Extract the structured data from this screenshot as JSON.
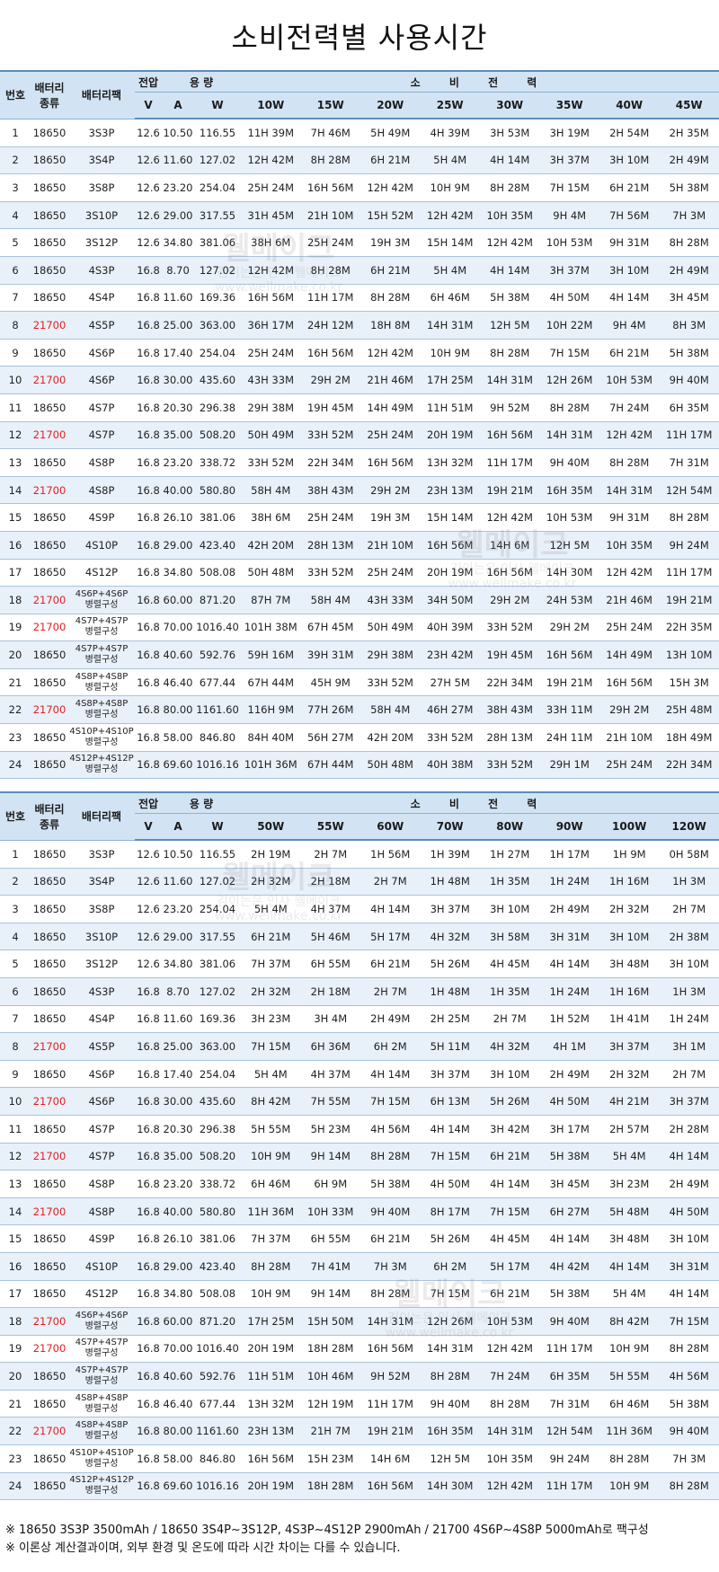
{
  "title": "소비전력별 사용시간",
  "headers": {
    "no": "번호",
    "battery_type": "배터리 종류",
    "pack": "배터리팩",
    "voltage_group": "전압",
    "capacity_group": "용 량",
    "consumption_group": "소 비 전 력",
    "v": "V",
    "a": "A",
    "w": "W"
  },
  "table1": {
    "watts": [
      "10W",
      "15W",
      "20W",
      "25W",
      "30W",
      "35W",
      "40W",
      "45W"
    ],
    "rows": [
      {
        "no": "1",
        "type": "18650",
        "pack": "3S3P",
        "v": "12.6",
        "a": "10.50",
        "w": "116.55",
        "t": [
          "11H 39M",
          "7H 46M",
          "5H 49M",
          "4H 39M",
          "3H 53M",
          "3H 19M",
          "2H 54M",
          "2H 35M"
        ]
      },
      {
        "no": "2",
        "type": "18650",
        "pack": "3S4P",
        "v": "12.6",
        "a": "11.60",
        "w": "127.02",
        "t": [
          "12H 42M",
          "8H 28M",
          "6H 21M",
          "5H 4M",
          "4H 14M",
          "3H 37M",
          "3H 10M",
          "2H 49M"
        ]
      },
      {
        "no": "3",
        "type": "18650",
        "pack": "3S8P",
        "v": "12.6",
        "a": "23.20",
        "w": "254.04",
        "t": [
          "25H 24M",
          "16H 56M",
          "12H 42M",
          "10H 9M",
          "8H 28M",
          "7H 15M",
          "6H 21M",
          "5H 38M"
        ]
      },
      {
        "no": "4",
        "type": "18650",
        "pack": "3S10P",
        "v": "12.6",
        "a": "29.00",
        "w": "317.55",
        "t": [
          "31H 45M",
          "21H 10M",
          "15H 52M",
          "12H 42M",
          "10H 35M",
          "9H 4M",
          "7H 56M",
          "7H 3M"
        ]
      },
      {
        "no": "5",
        "type": "18650",
        "pack": "3S12P",
        "v": "12.6",
        "a": "34.80",
        "w": "381.06",
        "t": [
          "38H 6M",
          "25H 24M",
          "19H 3M",
          "15H 14M",
          "12H 42M",
          "10H 53M",
          "9H 31M",
          "8H 28M"
        ]
      },
      {
        "no": "6",
        "type": "18650",
        "pack": "4S3P",
        "v": "16.8",
        "a": "8.70",
        "w": "127.02",
        "t": [
          "12H 42M",
          "8H 28M",
          "6H 21M",
          "5H 4M",
          "4H 14M",
          "3H 37M",
          "3H 10M",
          "2H 49M"
        ]
      },
      {
        "no": "7",
        "type": "18650",
        "pack": "4S4P",
        "v": "16.8",
        "a": "11.60",
        "w": "169.36",
        "t": [
          "16H 56M",
          "11H 17M",
          "8H 28M",
          "6H 46M",
          "5H 38M",
          "4H 50M",
          "4H 14M",
          "3H 45M"
        ]
      },
      {
        "no": "8",
        "type": "21700",
        "pack": "4S5P",
        "v": "16.8",
        "a": "25.00",
        "w": "363.00",
        "t": [
          "36H 17M",
          "24H 12M",
          "18H 8M",
          "14H 31M",
          "12H 5M",
          "10H 22M",
          "9H 4M",
          "8H 3M"
        ]
      },
      {
        "no": "9",
        "type": "18650",
        "pack": "4S6P",
        "v": "16.8",
        "a": "17.40",
        "w": "254.04",
        "t": [
          "25H 24M",
          "16H 56M",
          "12H 42M",
          "10H 9M",
          "8H 28M",
          "7H 15M",
          "6H 21M",
          "5H 38M"
        ]
      },
      {
        "no": "10",
        "type": "21700",
        "pack": "4S6P",
        "v": "16.8",
        "a": "30.00",
        "w": "435.60",
        "t": [
          "43H 33M",
          "29H 2M",
          "21H 46M",
          "17H 25M",
          "14H 31M",
          "12H 26M",
          "10H 53M",
          "9H 40M"
        ]
      },
      {
        "no": "11",
        "type": "18650",
        "pack": "4S7P",
        "v": "16.8",
        "a": "20.30",
        "w": "296.38",
        "t": [
          "29H 38M",
          "19H 45M",
          "14H 49M",
          "11H 51M",
          "9H 52M",
          "8H 28M",
          "7H 24M",
          "6H 35M"
        ]
      },
      {
        "no": "12",
        "type": "21700",
        "pack": "4S7P",
        "v": "16.8",
        "a": "35.00",
        "w": "508.20",
        "t": [
          "50H 49M",
          "33H 52M",
          "25H 24M",
          "20H 19M",
          "16H 56M",
          "14H 31M",
          "12H 42M",
          "11H 17M"
        ]
      },
      {
        "no": "13",
        "type": "18650",
        "pack": "4S8P",
        "v": "16.8",
        "a": "23.20",
        "w": "338.72",
        "t": [
          "33H 52M",
          "22H 34M",
          "16H 56M",
          "13H 32M",
          "11H 17M",
          "9H 40M",
          "8H 28M",
          "7H 31M"
        ]
      },
      {
        "no": "14",
        "type": "21700",
        "pack": "4S8P",
        "v": "16.8",
        "a": "40.00",
        "w": "580.80",
        "t": [
          "58H 4M",
          "38H 43M",
          "29H 2M",
          "23H 13M",
          "19H 21M",
          "16H 35M",
          "14H 31M",
          "12H 54M"
        ]
      },
      {
        "no": "15",
        "type": "18650",
        "pack": "4S9P",
        "v": "16.8",
        "a": "26.10",
        "w": "381.06",
        "t": [
          "38H 6M",
          "25H 24M",
          "19H 3M",
          "15H 14M",
          "12H 42M",
          "10H 53M",
          "9H 31M",
          "8H 28M"
        ]
      },
      {
        "no": "16",
        "type": "18650",
        "pack": "4S10P",
        "v": "16.8",
        "a": "29.00",
        "w": "423.40",
        "t": [
          "42H 20M",
          "28H 13M",
          "21H 10M",
          "16H 56M",
          "14H 6M",
          "12H 5M",
          "10H 35M",
          "9H 24M"
        ]
      },
      {
        "no": "17",
        "type": "18650",
        "pack": "4S12P",
        "v": "16.8",
        "a": "34.80",
        "w": "508.08",
        "t": [
          "50H 48M",
          "33H 52M",
          "25H 24M",
          "20H 19M",
          "16H 56M",
          "14H 30M",
          "12H 42M",
          "11H 17M"
        ]
      },
      {
        "no": "18",
        "type": "21700",
        "pack": "4S6P+4S6P",
        "pack2": "병렬구성",
        "v": "16.8",
        "a": "60.00",
        "w": "871.20",
        "t": [
          "87H 7M",
          "58H 4M",
          "43H 33M",
          "34H 50M",
          "29H 2M",
          "24H 53M",
          "21H 46M",
          "19H 21M"
        ]
      },
      {
        "no": "19",
        "type": "21700",
        "pack": "4S7P+4S7P",
        "pack2": "병렬구성",
        "v": "16.8",
        "a": "70.00",
        "w": "1016.40",
        "t": [
          "101H 38M",
          "67H 45M",
          "50H 49M",
          "40H 39M",
          "33H 52M",
          "29H 2M",
          "25H 24M",
          "22H 35M"
        ]
      },
      {
        "no": "20",
        "type": "18650",
        "pack": "4S7P+4S7P",
        "pack2": "병렬구성",
        "v": "16.8",
        "a": "40.60",
        "w": "592.76",
        "t": [
          "59H 16M",
          "39H 31M",
          "29H 38M",
          "23H 42M",
          "19H 45M",
          "16H 56M",
          "14H 49M",
          "13H 10M"
        ]
      },
      {
        "no": "21",
        "type": "18650",
        "pack": "4S8P+4S8P",
        "pack2": "병렬구성",
        "v": "16.8",
        "a": "46.40",
        "w": "677.44",
        "t": [
          "67H 44M",
          "45H 9M",
          "33H 52M",
          "27H 5M",
          "22H 34M",
          "19H 21M",
          "16H 56M",
          "15H 3M"
        ]
      },
      {
        "no": "22",
        "type": "21700",
        "pack": "4S8P+4S8P",
        "pack2": "병렬구성",
        "v": "16.8",
        "a": "80.00",
        "w": "1161.60",
        "t": [
          "116H 9M",
          "77H 26M",
          "58H 4M",
          "46H 27M",
          "38H 43M",
          "33H 11M",
          "29H 2M",
          "25H 48M"
        ]
      },
      {
        "no": "23",
        "type": "18650",
        "pack": "4S10P+4S10P",
        "pack2": "병렬구성",
        "v": "16.8",
        "a": "58.00",
        "w": "846.80",
        "t": [
          "84H 40M",
          "56H 27M",
          "42H 20M",
          "33H 52M",
          "28H 13M",
          "24H 11M",
          "21H 10M",
          "18H 49M"
        ]
      },
      {
        "no": "24",
        "type": "18650",
        "pack": "4S12P+4S12P",
        "pack2": "병렬구성",
        "v": "16.8",
        "a": "69.60",
        "w": "1016.16",
        "t": [
          "101H 36M",
          "67H 44M",
          "50H 48M",
          "40H 38M",
          "33H 52M",
          "29H 1M",
          "25H 24M",
          "22H 34M"
        ]
      }
    ]
  },
  "table2": {
    "watts": [
      "50W",
      "55W",
      "60W",
      "70W",
      "80W",
      "90W",
      "100W",
      "120W"
    ],
    "rows": [
      {
        "no": "1",
        "type": "18650",
        "pack": "3S3P",
        "v": "12.6",
        "a": "10.50",
        "w": "116.55",
        "t": [
          "2H 19M",
          "2H 7M",
          "1H 56M",
          "1H 39M",
          "1H 27M",
          "1H 17M",
          "1H 9M",
          "0H 58M"
        ]
      },
      {
        "no": "2",
        "type": "18650",
        "pack": "3S4P",
        "v": "12.6",
        "a": "11.60",
        "w": "127.02",
        "t": [
          "2H 32M",
          "2H 18M",
          "2H 7M",
          "1H 48M",
          "1H 35M",
          "1H 24M",
          "1H 16M",
          "1H 3M"
        ]
      },
      {
        "no": "3",
        "type": "18650",
        "pack": "3S8P",
        "v": "12.6",
        "a": "23.20",
        "w": "254.04",
        "t": [
          "5H 4M",
          "4H 37M",
          "4H 14M",
          "3H 37M",
          "3H 10M",
          "2H 49M",
          "2H 32M",
          "2H 7M"
        ]
      },
      {
        "no": "4",
        "type": "18650",
        "pack": "3S10P",
        "v": "12.6",
        "a": "29.00",
        "w": "317.55",
        "t": [
          "6H 21M",
          "5H 46M",
          "5H 17M",
          "4H 32M",
          "3H 58M",
          "3H 31M",
          "3H 10M",
          "2H 38M"
        ]
      },
      {
        "no": "5",
        "type": "18650",
        "pack": "3S12P",
        "v": "12.6",
        "a": "34.80",
        "w": "381.06",
        "t": [
          "7H 37M",
          "6H 55M",
          "6H 21M",
          "5H 26M",
          "4H 45M",
          "4H 14M",
          "3H 48M",
          "3H 10M"
        ]
      },
      {
        "no": "6",
        "type": "18650",
        "pack": "4S3P",
        "v": "16.8",
        "a": "8.70",
        "w": "127.02",
        "t": [
          "2H 32M",
          "2H 18M",
          "2H 7M",
          "1H 48M",
          "1H 35M",
          "1H 24M",
          "1H 16M",
          "1H 3M"
        ]
      },
      {
        "no": "7",
        "type": "18650",
        "pack": "4S4P",
        "v": "16.8",
        "a": "11.60",
        "w": "169.36",
        "t": [
          "3H 23M",
          "3H 4M",
          "2H 49M",
          "2H 25M",
          "2H 7M",
          "1H 52M",
          "1H 41M",
          "1H 24M"
        ]
      },
      {
        "no": "8",
        "type": "21700",
        "pack": "4S5P",
        "v": "16.8",
        "a": "25.00",
        "w": "363.00",
        "t": [
          "7H 15M",
          "6H 36M",
          "6H 2M",
          "5H 11M",
          "4H 32M",
          "4H 1M",
          "3H 37M",
          "3H 1M"
        ]
      },
      {
        "no": "9",
        "type": "18650",
        "pack": "4S6P",
        "v": "16.8",
        "a": "17.40",
        "w": "254.04",
        "t": [
          "5H 4M",
          "4H 37M",
          "4H 14M",
          "3H 37M",
          "3H 10M",
          "2H 49M",
          "2H 32M",
          "2H 7M"
        ]
      },
      {
        "no": "10",
        "type": "21700",
        "pack": "4S6P",
        "v": "16.8",
        "a": "30.00",
        "w": "435.60",
        "t": [
          "8H 42M",
          "7H 55M",
          "7H 15M",
          "6H 13M",
          "5H 26M",
          "4H 50M",
          "4H 21M",
          "3H 37M"
        ]
      },
      {
        "no": "11",
        "type": "18650",
        "pack": "4S7P",
        "v": "16.8",
        "a": "20.30",
        "w": "296.38",
        "t": [
          "5H 55M",
          "5H 23M",
          "4H 56M",
          "4H 14M",
          "3H 42M",
          "3H 17M",
          "2H 57M",
          "2H 28M"
        ]
      },
      {
        "no": "12",
        "type": "21700",
        "pack": "4S7P",
        "v": "16.8",
        "a": "35.00",
        "w": "508.20",
        "t": [
          "10H 9M",
          "9H 14M",
          "8H 28M",
          "7H 15M",
          "6H 21M",
          "5H 38M",
          "5H 4M",
          "4H 14M"
        ]
      },
      {
        "no": "13",
        "type": "18650",
        "pack": "4S8P",
        "v": "16.8",
        "a": "23.20",
        "w": "338.72",
        "t": [
          "6H 46M",
          "6H 9M",
          "5H 38M",
          "4H 50M",
          "4H 14M",
          "3H 45M",
          "3H 23M",
          "2H 49M"
        ]
      },
      {
        "no": "14",
        "type": "21700",
        "pack": "4S8P",
        "v": "16.8",
        "a": "40.00",
        "w": "580.80",
        "t": [
          "11H 36M",
          "10H 33M",
          "9H 40M",
          "8H 17M",
          "7H 15M",
          "6H 27M",
          "5H 48M",
          "4H 50M"
        ]
      },
      {
        "no": "15",
        "type": "18650",
        "pack": "4S9P",
        "v": "16.8",
        "a": "26.10",
        "w": "381.06",
        "t": [
          "7H 37M",
          "6H 55M",
          "6H 21M",
          "5H 26M",
          "4H 45M",
          "4H 14M",
          "3H 48M",
          "3H 10M"
        ]
      },
      {
        "no": "16",
        "type": "18650",
        "pack": "4S10P",
        "v": "16.8",
        "a": "29.00",
        "w": "423.40",
        "t": [
          "8H 28M",
          "7H 41M",
          "7H 3M",
          "6H 2M",
          "5H 17M",
          "4H 42M",
          "4H 14M",
          "3H 31M"
        ]
      },
      {
        "no": "17",
        "type": "18650",
        "pack": "4S12P",
        "v": "16.8",
        "a": "34.80",
        "w": "508.08",
        "t": [
          "10H 9M",
          "9H 14M",
          "8H 28M",
          "7H 15M",
          "6H 21M",
          "5H 38M",
          "5H 4M",
          "4H 14M"
        ]
      },
      {
        "no": "18",
        "type": "21700",
        "pack": "4S6P+4S6P",
        "pack2": "병렬구성",
        "v": "16.8",
        "a": "60.00",
        "w": "871.20",
        "t": [
          "17H 25M",
          "15H 50M",
          "14H 31M",
          "12H 26M",
          "10H 53M",
          "9H 40M",
          "8H 42M",
          "7H 15M"
        ]
      },
      {
        "no": "19",
        "type": "21700",
        "pack": "4S7P+4S7P",
        "pack2": "병렬구성",
        "v": "16.8",
        "a": "70.00",
        "w": "1016.40",
        "t": [
          "20H 19M",
          "18H 28M",
          "16H 56M",
          "14H 31M",
          "12H 42M",
          "11H 17M",
          "10H 9M",
          "8H 28M"
        ]
      },
      {
        "no": "20",
        "type": "18650",
        "pack": "4S7P+4S7P",
        "pack2": "병렬구성",
        "v": "16.8",
        "a": "40.60",
        "w": "592.76",
        "t": [
          "11H 51M",
          "10H 46M",
          "9H 52M",
          "8H 28M",
          "7H 24M",
          "6H 35M",
          "5H 55M",
          "4H 56M"
        ]
      },
      {
        "no": "21",
        "type": "18650",
        "pack": "4S8P+4S8P",
        "pack2": "병렬구성",
        "v": "16.8",
        "a": "46.40",
        "w": "677.44",
        "t": [
          "13H 32M",
          "12H 19M",
          "11H 17M",
          "9H 40M",
          "8H 28M",
          "7H 31M",
          "6H 46M",
          "5H 38M"
        ]
      },
      {
        "no": "22",
        "type": "21700",
        "pack": "4S8P+4S8P",
        "pack2": "병렬구성",
        "v": "16.8",
        "a": "80.00",
        "w": "1161.60",
        "t": [
          "23H 13M",
          "21H 7M",
          "19H 21M",
          "16H 35M",
          "14H 31M",
          "12H 54M",
          "11H 36M",
          "9H 40M"
        ]
      },
      {
        "no": "23",
        "type": "18650",
        "pack": "4S10P+4S10P",
        "pack2": "병렬구성",
        "v": "16.8",
        "a": "58.00",
        "w": "846.80",
        "t": [
          "16H 56M",
          "15H 23M",
          "14H 6M",
          "12H 5M",
          "10H 35M",
          "9H 24M",
          "8H 28M",
          "7H 3M"
        ]
      },
      {
        "no": "24",
        "type": "18650",
        "pack": "4S12P+4S12P",
        "pack2": "병렬구성",
        "v": "16.8",
        "a": "69.60",
        "w": "1016.16",
        "t": [
          "20H 19M",
          "18H 28M",
          "16H 56M",
          "14H 30M",
          "12H 42M",
          "11H 17M",
          "10H 9M",
          "8H 28M"
        ]
      }
    ]
  },
  "notes": [
    "※ 18650 3S3P 3500mAh / 18650 3S4P~3S12P, 4S3P~4S12P 2900mAh / 21700 4S6P~4S8P 5000mAh로 팩구성",
    "※ 이론상 계산결과이며, 외부 환경 및 온도에 따라 시간 차이는 다를 수 있습니다."
  ],
  "watermark": {
    "name": "웰메이크",
    "slogan": "김이는은 인사 웰메이크",
    "url": "www.wellmake.co.kr"
  },
  "colors": {
    "header_bg": "#d2e4f3",
    "alt_row_bg": "#e8f0f9",
    "highlight_text": "#e02020",
    "border": "#5b8dbd"
  }
}
